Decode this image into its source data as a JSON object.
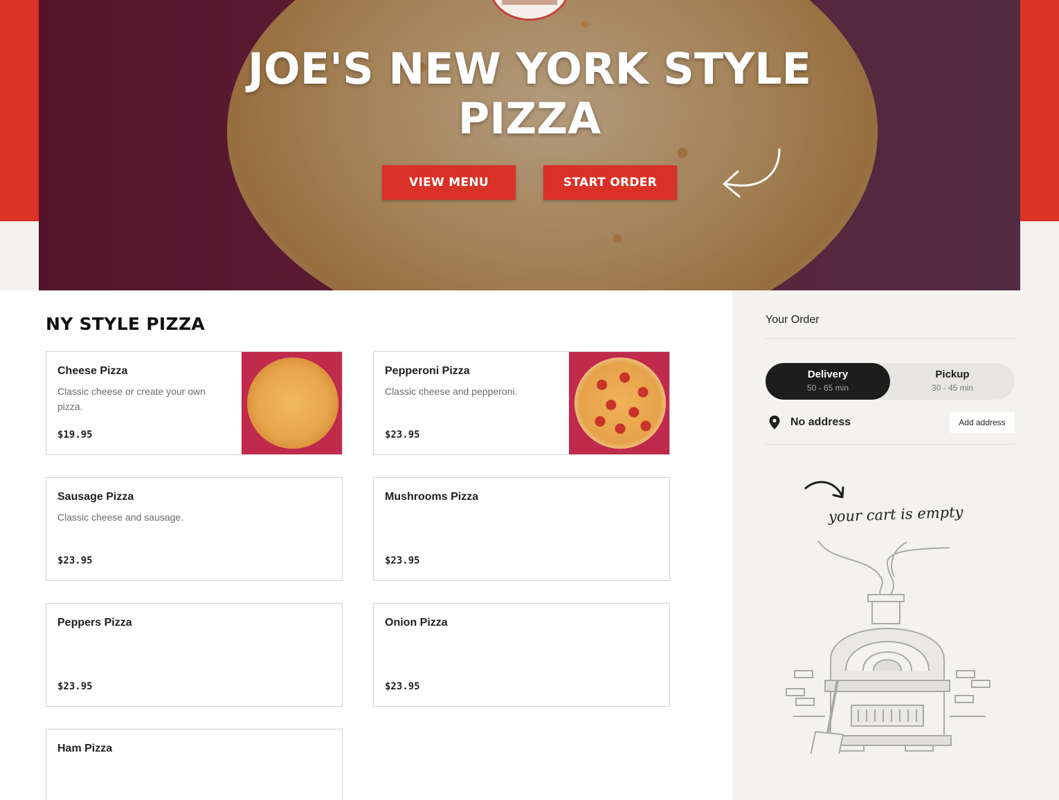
{
  "hero": {
    "title_line1": "JOE'S NEW YORK STYLE",
    "title_line2": "PIZZA",
    "view_menu_label": "VIEW MENU",
    "start_order_label": "START ORDER"
  },
  "menu": {
    "section_title": "NY STYLE PIZZA",
    "items": [
      {
        "name": "Cheese Pizza",
        "description": "Classic cheese or create your own pizza.",
        "price": "$19.95",
        "image": "cheese-pizza"
      },
      {
        "name": "Pepperoni Pizza",
        "description": "Classic cheese and pepperoni.",
        "price": "$23.95",
        "image": "pepperoni-pizza"
      },
      {
        "name": "Sausage Pizza",
        "description": "Classic cheese and sausage.",
        "price": "$23.95"
      },
      {
        "name": "Mushrooms Pizza",
        "description": "",
        "price": "$23.95"
      },
      {
        "name": "Peppers Pizza",
        "description": "",
        "price": "$23.95"
      },
      {
        "name": "Onion Pizza",
        "description": "",
        "price": "$23.95"
      },
      {
        "name": "Ham Pizza",
        "description": "",
        "price": ""
      }
    ]
  },
  "order": {
    "title": "Your Order",
    "delivery_label": "Delivery",
    "delivery_time": "50 - 65 min",
    "pickup_label": "Pickup",
    "pickup_time": "30 - 45 min",
    "selected_mode": "Delivery",
    "address_text": "No address",
    "add_address_label": "Add address",
    "empty_message": "your cart is empty"
  },
  "colors": {
    "brand_red": "#dc3327",
    "button_red": "#d93127",
    "toggle_active": "#1d1d1d",
    "sidebar_bg": "#f3f2ef"
  }
}
